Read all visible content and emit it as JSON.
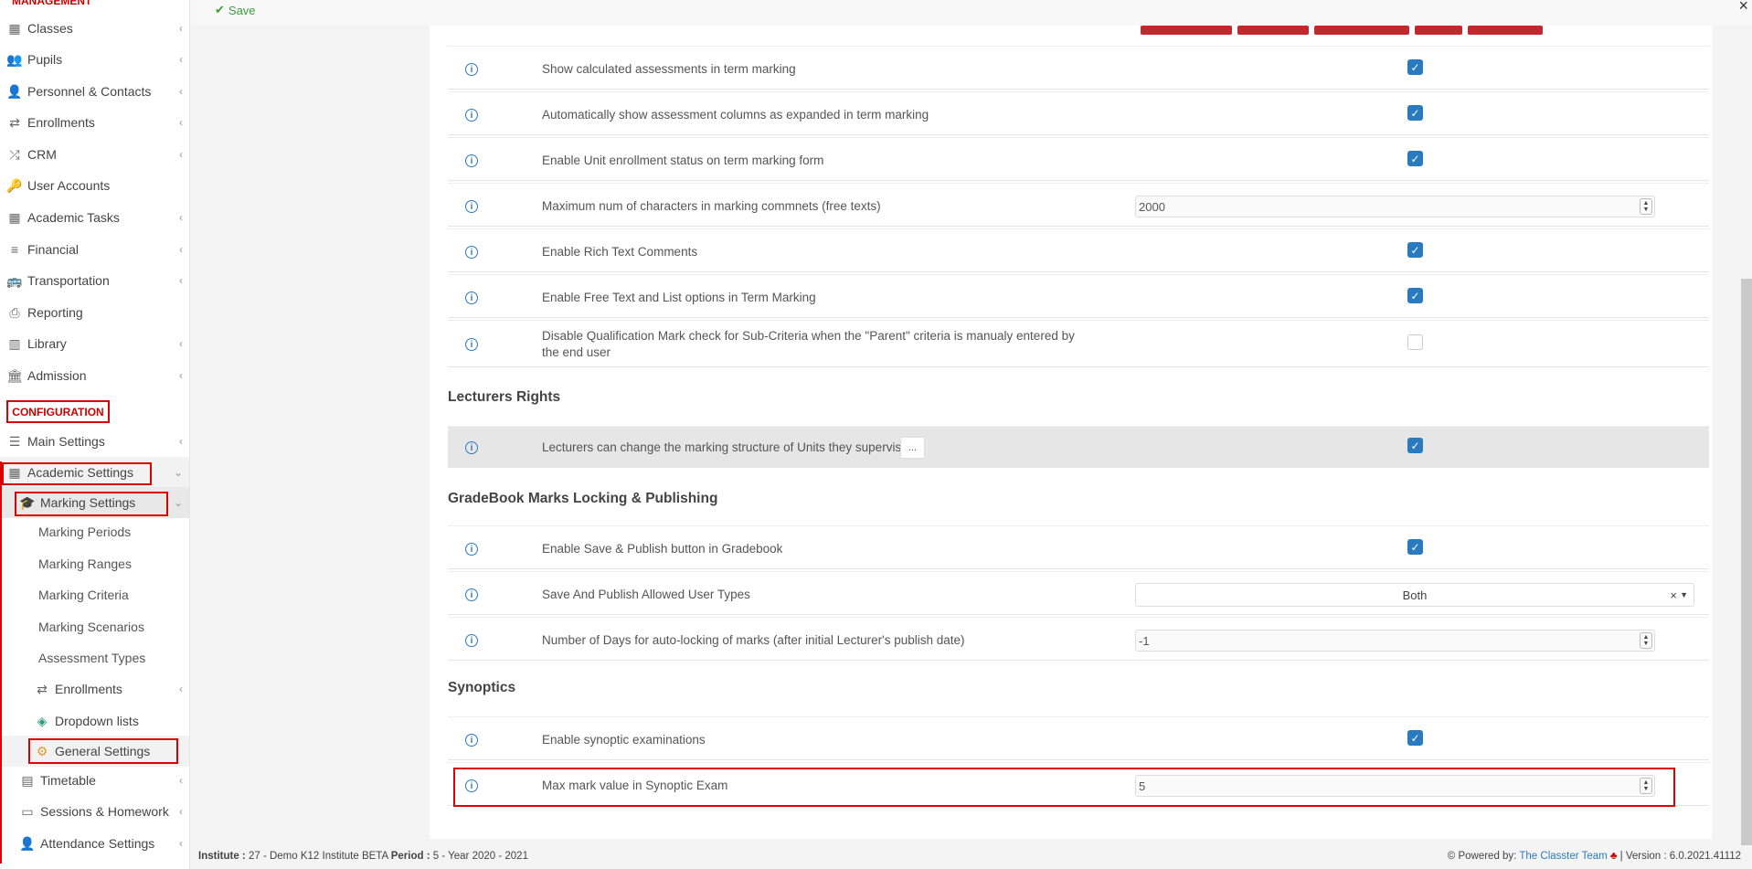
{
  "sidebar": {
    "top_label": "MANAGEMENT",
    "items": [
      {
        "label": "Classes",
        "icon": "grid-icon"
      },
      {
        "label": "Pupils",
        "icon": "users-icon"
      },
      {
        "label": "Personnel & Contacts",
        "icon": "contacts-icon"
      },
      {
        "label": "Enrollments",
        "icon": "swap-icon"
      },
      {
        "label": "CRM",
        "icon": "shuffle-icon"
      },
      {
        "label": "User Accounts",
        "icon": "key-icon"
      },
      {
        "label": "Academic Tasks",
        "icon": "dashboard-icon"
      },
      {
        "label": "Financial",
        "icon": "coins-icon"
      },
      {
        "label": "Transportation",
        "icon": "bus-icon"
      },
      {
        "label": "Reporting",
        "icon": "print-icon"
      },
      {
        "label": "Library",
        "icon": "books-icon"
      },
      {
        "label": "Admission",
        "icon": "bank-icon"
      }
    ],
    "config_label": "CONFIGURATION",
    "main_settings": "Main Settings",
    "academic_settings": "Academic Settings",
    "marking_settings": "Marking Settings",
    "marking_children": [
      "Marking Periods",
      "Marking Ranges",
      "Marking Criteria",
      "Marking Scenarios",
      "Assessment Types"
    ],
    "enrollments": "Enrollments",
    "dropdown_lists": "Dropdown lists",
    "general_settings": "General Settings",
    "timetable": "Timetable",
    "sessions": "Sessions & Homework",
    "attendance": "Attendance Settings"
  },
  "toolbar": {
    "save_label": "Save"
  },
  "rows": {
    "r1": "Show calculated assessments in term marking",
    "r2": "Automatically show assessment columns as expanded in term marking",
    "r3": "Enable Unit enrollment status on term marking form",
    "r4": "Maximum num of characters in marking commnets (free texts)",
    "r4_value": "2000",
    "r5": "Enable Rich Text Comments",
    "r6": "Enable Free Text and List options in Term Marking",
    "r7": "Disable Qualification Mark check for Sub-Criteria when the \"Parent\" criteria is manualy entered by the end user",
    "lecturers_heading": "Lecturers Rights",
    "r8": "Lecturers can change the marking structure of Units they supervise",
    "r8_more": "...",
    "gradebook_heading": "GradeBook Marks Locking & Publishing",
    "r9": "Enable Save & Publish button in Gradebook",
    "r10": "Save And Publish Allowed User Types",
    "r10_value": "Both",
    "r11": "Number of Days for auto-locking of marks (after initial Lecturer's publish date)",
    "r11_value": "-1",
    "synoptics_heading": "Synoptics",
    "r12": "Enable synoptic examinations",
    "r13": "Max mark value in Synoptic Exam",
    "r13_value": "5"
  },
  "footer": {
    "institute_label": "Institute :",
    "institute_value": "27 - Demo K12 Institute BETA",
    "period_label": "Period :",
    "period_value": "5 - Year 2020 - 2021",
    "powered_by": "Powered by:",
    "team": "The Classter Team",
    "version": "| Version : 6.0.2021.41112"
  },
  "colors": {
    "accent": "#2a7ac0",
    "highlight": "#d00000",
    "save": "#3a9d3a"
  }
}
